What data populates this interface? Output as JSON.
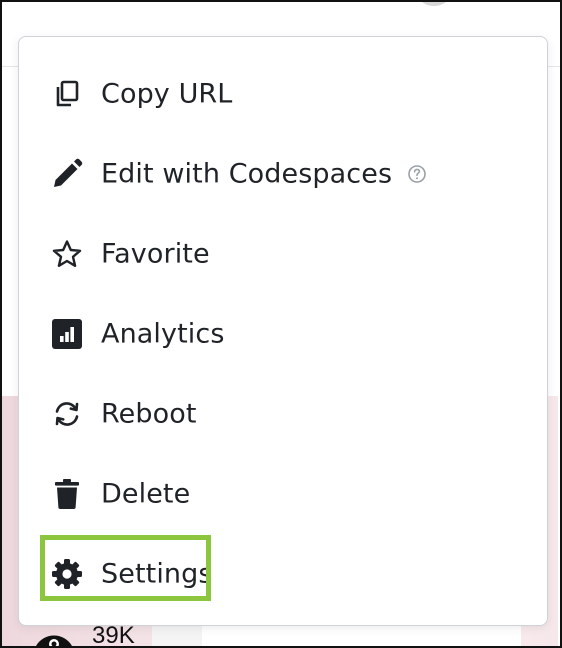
{
  "menu": {
    "items": [
      {
        "label": "Copy URL",
        "icon": "copy-icon"
      },
      {
        "label": "Edit with Codespaces",
        "icon": "pencil-icon",
        "help_icon": "help-circle-icon"
      },
      {
        "label": "Favorite",
        "icon": "star-icon"
      },
      {
        "label": "Analytics",
        "icon": "analytics-icon"
      },
      {
        "label": "Reboot",
        "icon": "reboot-icon"
      },
      {
        "label": "Delete",
        "icon": "trash-icon"
      },
      {
        "label": "Settings",
        "icon": "gear-icon",
        "highlighted": true
      }
    ]
  },
  "background": {
    "views_count": "39K",
    "views_icon": "eye-icon"
  },
  "colors": {
    "highlight": "#8cc63f",
    "text": "#1f2328",
    "menu_border": "#cfd3d8"
  }
}
